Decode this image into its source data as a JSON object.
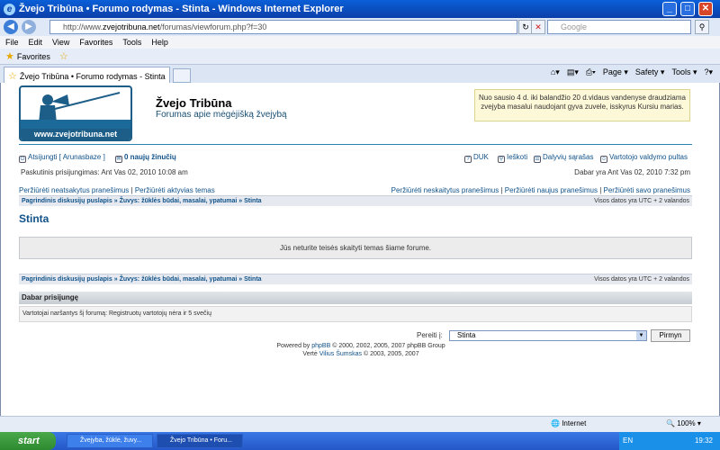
{
  "window": {
    "title": "Žvejo Tribūna • Forumo rodymas - Stinta - Windows Internet Explorer"
  },
  "browser": {
    "url_prefix": "http://www.",
    "url_domain": "zvejotribuna.net",
    "url_path": "/forumas/viewforum.php?f=30",
    "search_placeholder": "Google",
    "menu": [
      "File",
      "Edit",
      "View",
      "Favorites",
      "Tools",
      "Help"
    ],
    "favorites_label": "Favorites",
    "tab_title": "Žvejo Tribūna • Forumo rodymas - Stinta",
    "tools": {
      "page": "Page ▾",
      "safety": "Safety ▾",
      "tools": "Tools ▾"
    }
  },
  "site": {
    "logo_url_text": "www.zvejotribuna.net",
    "title": "Žvejo Tribūna",
    "description": "Forumas apie mėgėjišką žvejybą",
    "notice": "Nuo sausio 4 d. iki balandžio 20 d.vidaus vandenyse draudziama zvejyba masalui naudojant gyva zuvele, isskyrus Kursiu marias."
  },
  "userbar": {
    "logout": "Atsijungti [ Arunasbaze ]",
    "messages": "0 naujų žinučių",
    "faq": "DUK",
    "search": "Ieškoti",
    "members": "Dalyvių sąrašas",
    "ucp": "Vartotojo valdymo pultas",
    "last_login": "Paskutinis prisijungimas: Ant Vas 02, 2010 10:08 am",
    "now": "Dabar yra Ant Vas 02, 2010 7:32 pm"
  },
  "links": {
    "unanswered": "Peržiūrėti neatsakytus pranešimus",
    "active": "Peržiūrėti aktyvias temas",
    "unread": "Peržiūrėti neskaitytus pranešimus",
    "new": "Peržiūrėti naujus pranešimus",
    "own": "Peržiūrėti savo pranešimus",
    "sep": "|"
  },
  "breadcrumb": {
    "home": "Pagrindinis diskusijų puslapis",
    "cat": "Žuvys: žūklės būdai, masalai, ypatumai",
    "forum": "Stinta",
    "arrow": "»",
    "tz": "Visos datos yra UTC + 2 valandos"
  },
  "forum": {
    "title": "Stinta",
    "message": "Jūs neturite teisės skaityti temas šiame forume."
  },
  "online": {
    "header": "Dabar prisijungę",
    "text": "Vartotojai naršantys šį forumą: Registruotų vartotojų nėra ir 5 svečių"
  },
  "jump": {
    "label": "Pereiti į:",
    "selected": "Stinta",
    "button": "Pirmyn"
  },
  "footer": {
    "powered_pre": "Powered by ",
    "phpbb": "phpBB",
    "powered_post": " © 2000, 2002, 2005, 2007 phpBB Group",
    "trans_pre": "Vertė ",
    "translator": "Vilius Šumskas",
    "trans_post": " © 2003, 2005, 2007"
  },
  "status": {
    "zone": "Internet",
    "zoom": "100%"
  },
  "taskbar": {
    "start": "start",
    "task1": "Žvejyba, žūklė, žuvy...",
    "task2": "Žvejo Tribūna • Foru...",
    "lang": "EN",
    "clock": "19:32"
  }
}
